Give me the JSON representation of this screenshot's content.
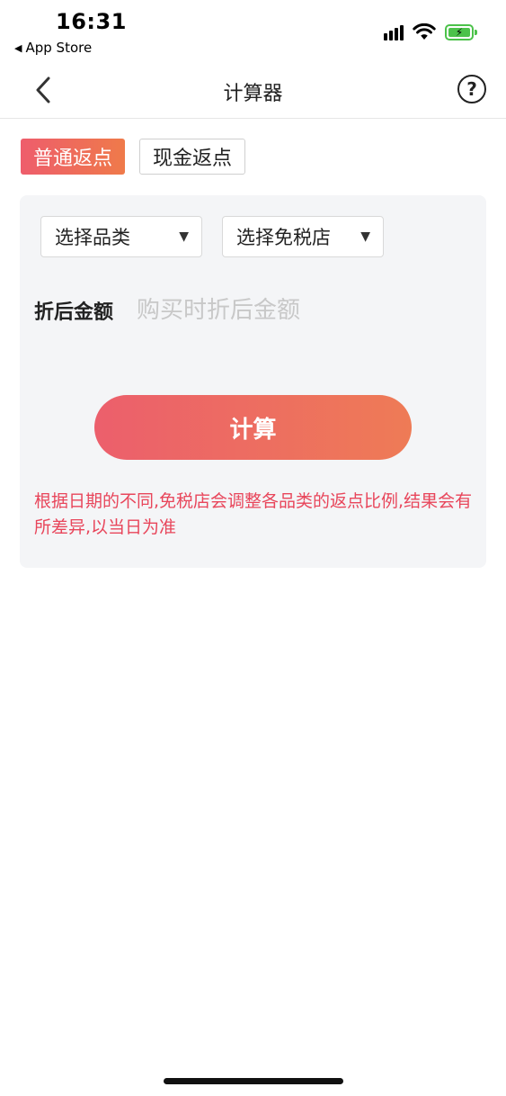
{
  "status_bar": {
    "time": "16:31",
    "back_app_label": "App Store",
    "back_app_arrow": "◀",
    "battery_bolt": "⚡"
  },
  "nav": {
    "back_icon": "chevron-left-icon",
    "title": "计算器",
    "help_icon": "question-circle-icon",
    "help_glyph": "?"
  },
  "tabs": [
    {
      "label": "普通返点",
      "active": true
    },
    {
      "label": "现金返点",
      "active": false
    }
  ],
  "form": {
    "category_select": {
      "value": "选择品类",
      "caret": "▼"
    },
    "store_select": {
      "value": "选择免税店",
      "caret": "▼"
    },
    "amount_label": "折后金额",
    "amount_placeholder": "购买时折后金额",
    "amount_value": ""
  },
  "calc_button_label": "计算",
  "note": "根据日期的不同,免税店会调整各品类的返点比例,结果会有所差异,以当日为准",
  "colors": {
    "accent_start": "#ee5d6c",
    "accent_end": "#ef7a4a",
    "note_text": "#e8465b",
    "card_bg": "#f4f5f7",
    "battery_green": "#4cc24a"
  }
}
